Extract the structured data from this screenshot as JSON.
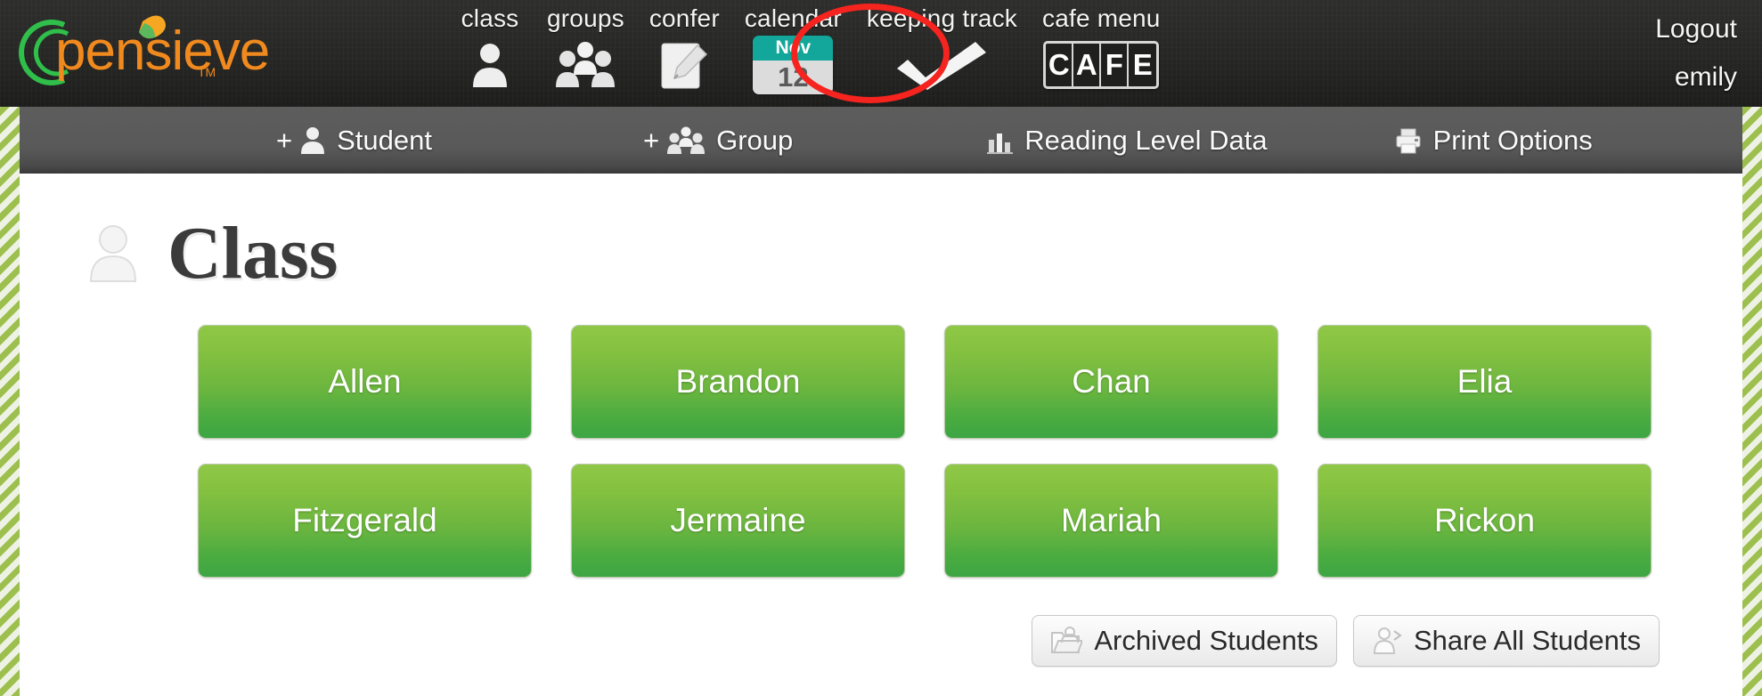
{
  "brand": {
    "name": "pensieve",
    "trademark": "TM",
    "arc_color": "#2fbf4a",
    "text_color": "#f08a1e",
    "leaf_colors": [
      "#f5a623",
      "#4caf50"
    ]
  },
  "header": {
    "nav": [
      {
        "label": "class",
        "icon": "person-icon"
      },
      {
        "label": "groups",
        "icon": "group-icon"
      },
      {
        "label": "confer",
        "icon": "note-pencil-icon"
      },
      {
        "label": "calendar",
        "icon": "calendar-icon",
        "month": "Nov",
        "day": "12",
        "highlighted": true
      },
      {
        "label": "keeping track",
        "icon": "checkmark-icon"
      },
      {
        "label": "cafe menu",
        "icon": "cafe-icon",
        "letters": [
          "C",
          "A",
          "F",
          "E"
        ]
      }
    ],
    "logout_label": "Logout",
    "username": "emily",
    "annotation": {
      "shape": "ellipse",
      "color": "#f5241f",
      "targets": "calendar"
    }
  },
  "toolbar": {
    "items": [
      {
        "label": "Student",
        "prefix": "+",
        "icon": "add-person-icon"
      },
      {
        "label": "Group",
        "prefix": "+",
        "icon": "add-group-icon"
      },
      {
        "label": "Reading Level Data",
        "prefix": "",
        "icon": "bar-chart-icon"
      },
      {
        "label": "Print Options",
        "prefix": "",
        "icon": "printer-icon"
      }
    ]
  },
  "main": {
    "page_title": "Class",
    "page_icon": "person-icon",
    "students": [
      {
        "name": "Allen"
      },
      {
        "name": "Brandon"
      },
      {
        "name": "Chan"
      },
      {
        "name": "Elia"
      },
      {
        "name": "Fitzgerald"
      },
      {
        "name": "Jermaine"
      },
      {
        "name": "Mariah"
      },
      {
        "name": "Rickon"
      }
    ],
    "actions": [
      {
        "label": "Archived Students",
        "icon": "folder-person-icon"
      },
      {
        "label": "Share All Students",
        "icon": "person-share-icon"
      }
    ]
  },
  "colors": {
    "header_bg": "#262625",
    "toolbar_bg": "#595959",
    "student_green_top": "#8fc846",
    "student_green_bottom": "#3da544",
    "calendar_teal": "#12a79a",
    "annotation_red": "#f5241f",
    "rail_green": "#9cbf4e"
  }
}
